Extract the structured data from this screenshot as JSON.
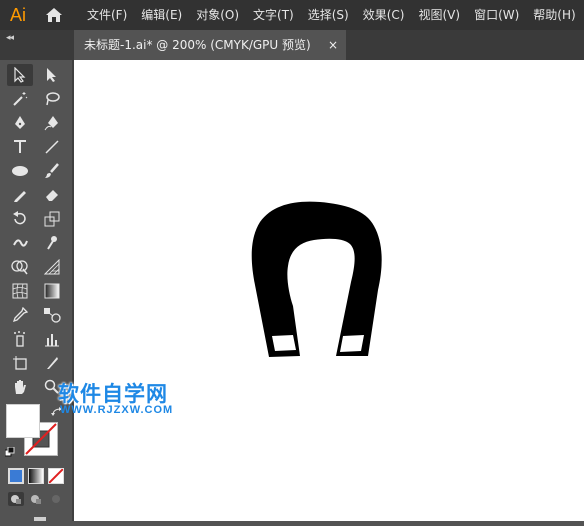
{
  "app": {
    "logo": "Ai",
    "accent": "#ff9a00"
  },
  "menu": {
    "items": [
      {
        "label": "文件(F)"
      },
      {
        "label": "编辑(E)"
      },
      {
        "label": "对象(O)"
      },
      {
        "label": "文字(T)"
      },
      {
        "label": "选择(S)"
      },
      {
        "label": "效果(C)"
      },
      {
        "label": "视图(V)"
      },
      {
        "label": "窗口(W)"
      },
      {
        "label": "帮助(H)"
      }
    ]
  },
  "panel": {
    "collapse": "◂◂"
  },
  "document": {
    "tab_title": "未标题-1.ai* @ 200% (CMYK/GPU 预览)",
    "close": "×"
  },
  "watermark": {
    "title": "软件自学网",
    "url": "WWW.RJZXW.COM",
    "color": "#1e88e5"
  },
  "colors": {
    "fill": "#ffffff",
    "stroke": "none"
  },
  "icons": [
    "selection-tool-icon",
    "direct-selection-tool-icon",
    "magic-wand-icon",
    "lasso-icon",
    "pen-tool-icon",
    "curvature-tool-icon",
    "type-tool-icon",
    "line-tool-icon",
    "ellipse-tool-icon",
    "paintbrush-icon",
    "pencil-icon",
    "eraser-icon",
    "rotate-tool-icon",
    "scale-tool-icon",
    "warp-tool-icon",
    "puppet-warp-icon",
    "shape-builder-icon",
    "perspective-grid-icon",
    "mesh-tool-icon",
    "gradient-tool-icon",
    "eyedropper-icon",
    "blend-tool-icon",
    "symbol-sprayer-icon",
    "column-graph-icon",
    "artboard-tool-icon",
    "slice-tool-icon",
    "hand-tool-icon",
    "zoom-tool-icon"
  ]
}
